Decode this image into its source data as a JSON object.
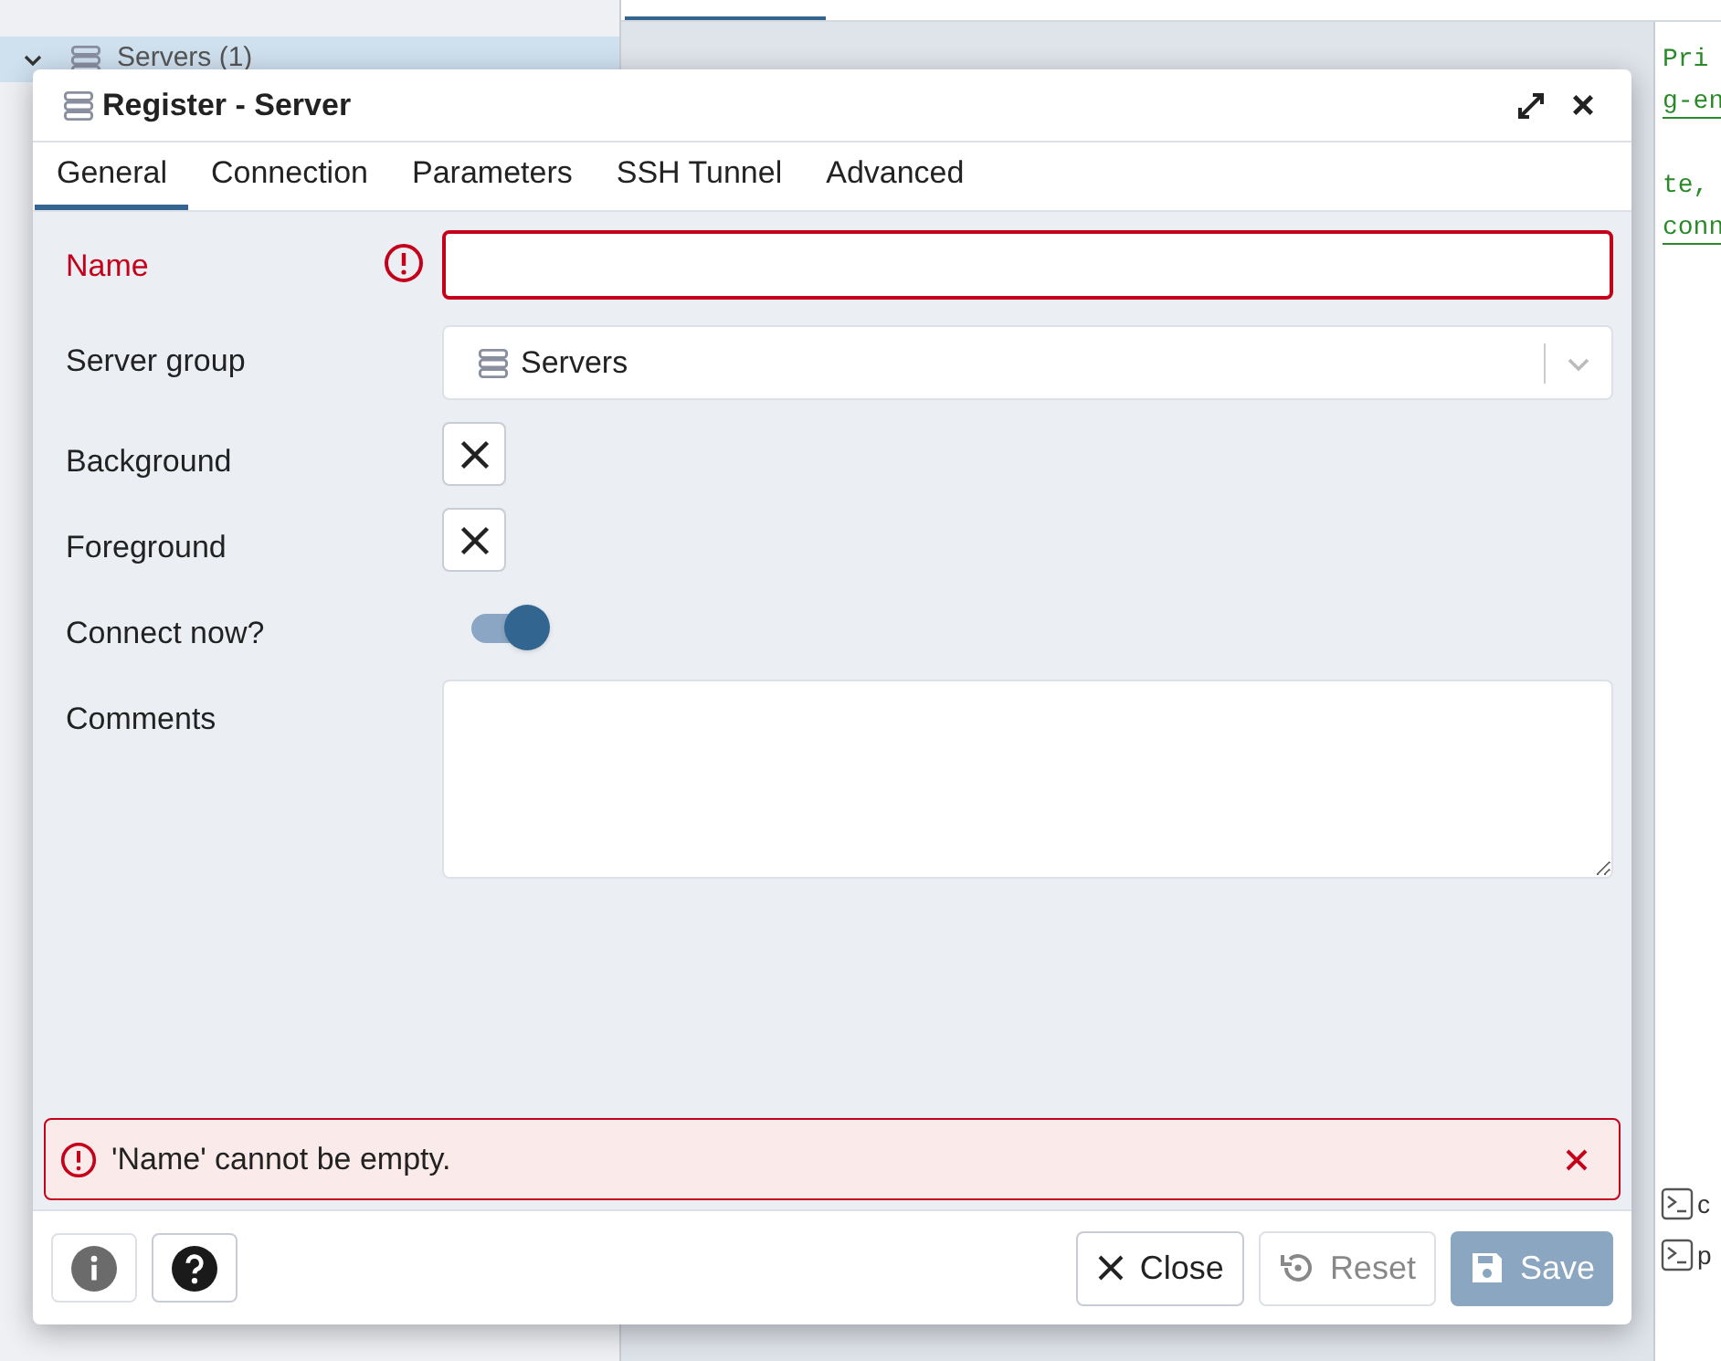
{
  "background": {
    "tree_item": {
      "label": "Servers (1)",
      "expanded": true
    },
    "code_lines": [
      {
        "text": "Pri",
        "link": false
      },
      {
        "text": "g-en",
        "link": true
      },
      {
        "text": "te,",
        "link": false
      },
      {
        "text": "conn",
        "link": true
      }
    ],
    "terminal_items": [
      "c",
      "p"
    ]
  },
  "dialog": {
    "title": "Register - Server",
    "tabs": [
      {
        "label": "General",
        "selected": true
      },
      {
        "label": "Connection",
        "selected": false
      },
      {
        "label": "Parameters",
        "selected": false
      },
      {
        "label": "SSH Tunnel",
        "selected": false
      },
      {
        "label": "Advanced",
        "selected": false
      }
    ],
    "fields": [
      {
        "kind": "text",
        "label": "Name",
        "invalid": true
      },
      {
        "kind": "select",
        "label": "Server group",
        "value": "Servers",
        "invalid": false
      },
      {
        "kind": "color",
        "label": "Background",
        "invalid": false
      },
      {
        "kind": "color",
        "label": "Foreground",
        "invalid": false
      },
      {
        "kind": "toggle",
        "label": "Connect now?",
        "on": true,
        "invalid": false
      },
      {
        "kind": "textarea",
        "label": "Comments",
        "invalid": false
      }
    ],
    "error": "'Name' cannot be empty.",
    "buttons": [
      {
        "kind": "close",
        "label": "Close",
        "disabled": false
      },
      {
        "kind": "reset",
        "label": "Reset",
        "disabled": true
      },
      {
        "kind": "save",
        "label": "Save",
        "disabled": true
      }
    ]
  }
}
